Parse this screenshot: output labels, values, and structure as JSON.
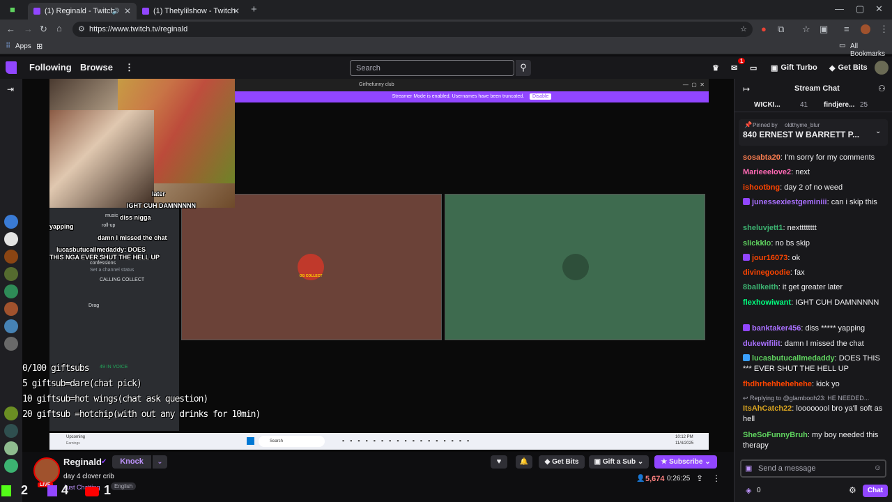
{
  "browser": {
    "tabs": [
      {
        "title": "(1) Reginald - Twitch",
        "active": true
      },
      {
        "title": "(1) Thetylilshow - Twitch",
        "active": false
      }
    ],
    "url": "https://www.twitch.tv/reginald",
    "bookmarks": {
      "apps": "Apps",
      "all": "All Bookmarks"
    }
  },
  "twitch": {
    "nav": {
      "following": "Following",
      "browse": "Browse",
      "more": "⋮"
    },
    "search_placeholder": "Search",
    "gift_turbo": "Gift Turbo",
    "get_bits": "Get Bits",
    "notif_count": "1"
  },
  "video": {
    "window_title": "Girlhefunny club",
    "streamer_mode": "Streamer Mode is enabled. Usernames have been truncated.",
    "disable": "Disable",
    "tile1_label": "OG COLLECT",
    "overlay_lines": [
      "0/100 giftsubs",
      "5 giftsub=dare(chat pick)",
      "10 giftsub=hot wings(chat ask question)",
      "20 giftsub =hotchip(with out any drinks for 10min)"
    ],
    "chat_overlay": [
      "later",
      "IGHT CUH DAMNNNNN",
      "diss nigga",
      "yapping",
      "damn I missed the chat",
      "lucasbutucallmedaddy: DOES",
      "THIS NGA EVER SHUT THE HELL UP"
    ],
    "discord": {
      "roll_up": "roll-up",
      "music": "music",
      "confessions": "confessions",
      "channel_status": "Set a channel status",
      "calling": "CALLING COLLECT",
      "drag": "Drag",
      "in_voice": "49 IN VOICE"
    },
    "taskbar": {
      "search": "Search",
      "upcoming": "Upcoming",
      "upcoming_sub": "Earnings",
      "time": "10:12 PM",
      "date": "11/4/2025"
    }
  },
  "channel": {
    "name": "Reginald",
    "title": "day 4 clover crib",
    "category": "Just Chatting",
    "tag": "English",
    "knock": "Knock",
    "get_bits": "Get Bits",
    "gift_sub": "Gift a Sub",
    "subscribe": "Subscribe",
    "viewers": "5,674",
    "uptime": "0:26:25",
    "overlay_counts": [
      "2",
      "4",
      "1"
    ]
  },
  "chat": {
    "header": "Stream Chat",
    "top_gifters": [
      {
        "name": "WICKI...",
        "count": "41"
      },
      {
        "name": "findjere...",
        "count": "25"
      }
    ],
    "pinned_by": "Pinned by",
    "pinned_user": "oldthyme_blur",
    "pinned_text": "840 ERNEST W BARRETT P...",
    "messages": [
      {
        "user": "sosabta20",
        "color": "#ff7f50",
        "text": "I'm sorry for my comments"
      },
      {
        "user": "Marieeelove2",
        "color": "#ff69b4",
        "text": "next"
      },
      {
        "user": "ishootbng",
        "color": "#ff4500",
        "text": "day 2 of no weed"
      },
      {
        "user": "junessexiestgeminiii",
        "color": "#a970ff",
        "text": "can i skip this"
      },
      {
        "user": "sheluvjett1",
        "color": "#3cb371",
        "text": "nextttttttt"
      },
      {
        "user": "slickklo",
        "color": "#5fd35f",
        "text": "no bs skip"
      },
      {
        "user": "jour16073",
        "color": "#ff4500",
        "text": "ok"
      },
      {
        "user": "divinegoodie",
        "color": "#ff4500",
        "text": "fax"
      },
      {
        "user": "8ballkeith",
        "color": "#3cb371",
        "text": "it get greater later"
      },
      {
        "user": "flexhowiwant",
        "color": "#00ff7f",
        "text": "IGHT CUH DAMNNNNN"
      },
      {
        "user": "banktaker456",
        "color": "#a970ff",
        "text": "diss ***** yapping"
      },
      {
        "user": "dukewifilit",
        "color": "#a970ff",
        "text": "damn I missed the chat"
      },
      {
        "user": "lucasbutucallmedaddy",
        "color": "#5fd35f",
        "text": "DOES THIS *** EVER SHUT THE HELL UP"
      },
      {
        "user": "fhdhrhehhehehehe",
        "color": "#ff4500",
        "text": "kick yo"
      },
      {
        "user": "ItsAhCatch22",
        "color": "#daa520",
        "text": "loooooool bro ya'll soft as hell"
      },
      {
        "user": "SheSoFunnyBruh",
        "color": "#5fd35f",
        "text": "my boy needed this therapy"
      }
    ],
    "reply_to": "Replying to @glambooh23: HE NEEDED...",
    "input_placeholder": "Send a message",
    "points": "0",
    "chat_button": "Chat"
  },
  "colors": {
    "accent": "#9146ff",
    "bg": "#0e0e10",
    "panel": "#18181b"
  }
}
